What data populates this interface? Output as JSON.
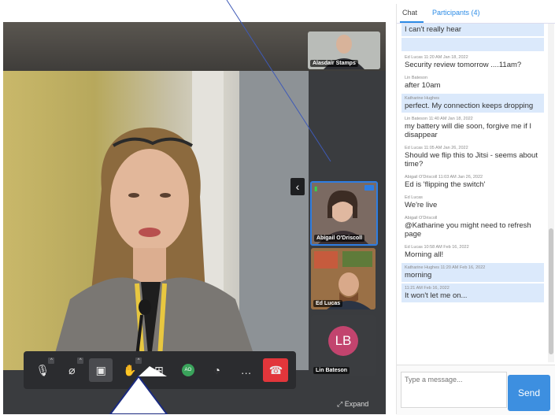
{
  "chat_panel": {
    "tabs": [
      {
        "label": "Chat"
      },
      {
        "label": "Participants (4)"
      }
    ],
    "messages": [
      {
        "meta": "",
        "text": "I can't really hear",
        "highlight": true
      },
      {
        "meta": "",
        "text": "",
        "highlight": true
      },
      {
        "meta": "Ed Lucas  11:20 AM Jan 18, 2022",
        "text": "Security review tomorrow ....11am?",
        "highlight": false
      },
      {
        "meta": "Lin Bateson",
        "text": "after 10am",
        "highlight": false
      },
      {
        "meta": "Katharine Hughes",
        "text": "perfect. My connection keeps dropping",
        "highlight": true
      },
      {
        "meta": "Lin Bateson  11:40 AM Jan 18, 2022",
        "text": "my battery will die soon, forgive me if I disappear",
        "highlight": false
      },
      {
        "meta": "Ed Lucas  11:05 AM Jan 26, 2022",
        "text": "Should we flip this to Jitsi - seems about time?",
        "highlight": false
      },
      {
        "meta": "Abigail O'Driscoll  11:03 AM Jan 26, 2022",
        "text": "Ed is 'flipping the switch'",
        "highlight": false
      },
      {
        "meta": "Ed Lucas",
        "text": "We're live",
        "highlight": false
      },
      {
        "meta": "Abigail O'Driscoll",
        "text": "@Katharine you might need to refresh page",
        "highlight": false
      },
      {
        "meta": "Ed Lucas  10:58 AM Feb 16, 2022",
        "text": "Morning all!",
        "highlight": false
      },
      {
        "meta": "Katharine Hughes  11:20 AM Feb 16, 2022",
        "text": "morning",
        "highlight": true
      },
      {
        "meta": "11:21 AM Feb 16, 2022",
        "text": "It won't let me on...",
        "highlight": true
      }
    ],
    "composer": {
      "placeholder": "Type a message...",
      "send_label": "Send"
    }
  },
  "video": {
    "participants": {
      "top": "Alasdair Stamps",
      "active": "Abigail O'Driscoll",
      "second": "Ed Lucas",
      "third": "Lin Bateson",
      "third_initials": "LB",
      "third_avatar_color": "#c2446e"
    },
    "expand_label": "Expand",
    "collapse_glyph": "‹",
    "toolbar": [
      {
        "name": "microphone-icon",
        "glyph": "🎙",
        "caret": true
      },
      {
        "name": "camera-off-icon",
        "glyph": "⌀",
        "caret": true
      },
      {
        "name": "screen-share-icon",
        "glyph": "▣",
        "caret": false
      },
      {
        "name": "raise-hand-icon",
        "glyph": "✋",
        "caret": true
      },
      {
        "name": "tile-view-icon",
        "glyph": "⊞",
        "caret": false
      },
      {
        "name": "avatar-button",
        "glyph": "AO",
        "caret": false
      },
      {
        "name": "performance-icon",
        "glyph": "◔",
        "caret": false
      },
      {
        "name": "more-icon",
        "glyph": "…",
        "caret": false
      },
      {
        "name": "hangup-icon",
        "glyph": "☎",
        "caret": false
      }
    ]
  },
  "colors": {
    "accent": "#2b8be6",
    "send": "#3d8fe0",
    "hangup": "#e2363b",
    "active_border": "#2f7de1"
  }
}
